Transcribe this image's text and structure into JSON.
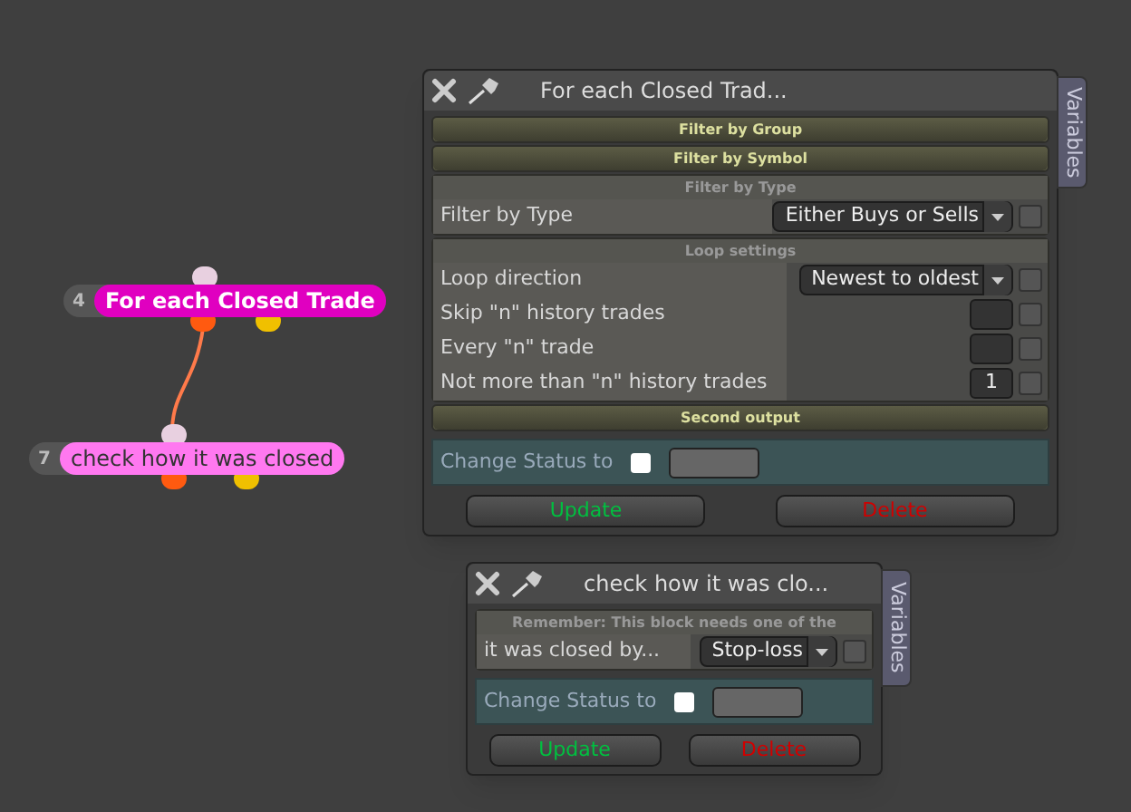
{
  "nodes": [
    {
      "number": "4",
      "label": "For each Closed Trade",
      "selected": true
    },
    {
      "number": "7",
      "label": "check how it was closed",
      "selected": false
    }
  ],
  "panels": [
    {
      "title": "For each Closed Trad...",
      "side_tab": "Variables",
      "sections": [
        {
          "label": "Filter by Group",
          "expanded": false
        },
        {
          "label": "Filter by Symbol",
          "expanded": false
        },
        {
          "label": "Filter by Type",
          "expanded": true,
          "rows": [
            {
              "kind": "dropdown",
              "label": "Filter by Type",
              "value": "Either Buys or Sells",
              "checked": false
            }
          ]
        },
        {
          "label": "Loop settings",
          "expanded": true,
          "rows": [
            {
              "kind": "dropdown",
              "label": "Loop direction",
              "value": "Newest to oldest",
              "checked": false
            },
            {
              "kind": "number",
              "label": "Skip \"n\" history trades",
              "checked": false
            },
            {
              "kind": "number",
              "label": "Every \"n\" trade",
              "checked": false
            },
            {
              "kind": "number",
              "label": "Not more than \"n\" history trades",
              "value": "1",
              "checked": false
            }
          ]
        },
        {
          "label": "Second output",
          "expanded": false
        }
      ],
      "status": {
        "label": "Change Status to",
        "checked": false
      },
      "buttons": [
        {
          "label": "Update",
          "kind": "confirm"
        },
        {
          "label": "Delete",
          "kind": "danger"
        }
      ]
    },
    {
      "title": "check how it was clo...",
      "side_tab": "Variables",
      "sections": [
        {
          "label": "Remember: This block needs one of the",
          "expanded": true,
          "rows": [
            {
              "kind": "dropdown",
              "label": "it was closed by...",
              "value": "Stop-loss",
              "checked": false
            }
          ]
        }
      ],
      "status": {
        "label": "Change Status to",
        "checked": false
      },
      "buttons": [
        {
          "label": "Update",
          "kind": "confirm"
        },
        {
          "label": "Delete",
          "kind": "danger"
        }
      ]
    }
  ]
}
